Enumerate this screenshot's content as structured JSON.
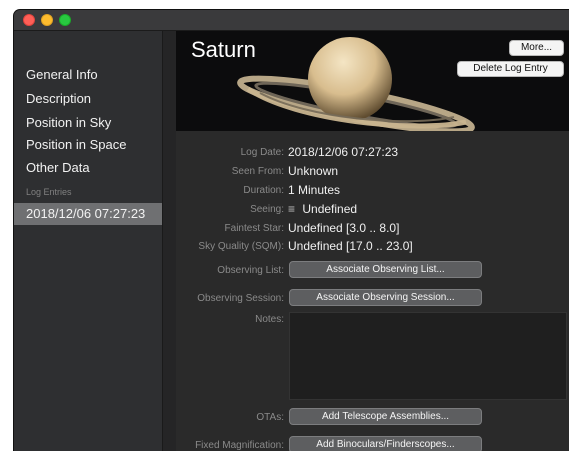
{
  "sidebar": {
    "items": [
      {
        "label": "General Info"
      },
      {
        "label": "Description"
      },
      {
        "label": "Position in Sky"
      },
      {
        "label": "Position in Space"
      },
      {
        "label": "Other Data"
      }
    ],
    "section_label": "Log Entries",
    "log_entries": [
      {
        "label": "2018/12/06 07:27:23",
        "selected": true
      }
    ]
  },
  "header": {
    "title": "Saturn",
    "more_label": "More...",
    "delete_label": "Delete Log Entry"
  },
  "details": {
    "log_date": {
      "label": "Log Date:",
      "value": "2018/12/06 07:27:23"
    },
    "seen_from": {
      "label": "Seen From:",
      "value": "Unknown"
    },
    "duration": {
      "label": "Duration:",
      "value": "1 Minutes"
    },
    "seeing": {
      "label": "Seeing:",
      "value": "Undefined"
    },
    "faintest_star": {
      "label": "Faintest Star:",
      "value": "Undefined [3.0 .. 8.0]"
    },
    "sky_quality": {
      "label": "Sky Quality (SQM):",
      "value": "Undefined [17.0 .. 23.0]"
    },
    "observing_list": {
      "label": "Observing List:",
      "button": "Associate Observing List..."
    },
    "observing_session": {
      "label": "Observing Session:",
      "button": "Associate Observing Session..."
    },
    "notes": {
      "label": "Notes:",
      "value": ""
    },
    "otas": {
      "label": "OTAs:",
      "button": "Add Telescope Assemblies..."
    },
    "fixed_magnification": {
      "label": "Fixed Magnification:",
      "button": "Add Binoculars/Finderscopes..."
    }
  },
  "icons": {
    "seeing_icon": "menu-lines-icon"
  }
}
